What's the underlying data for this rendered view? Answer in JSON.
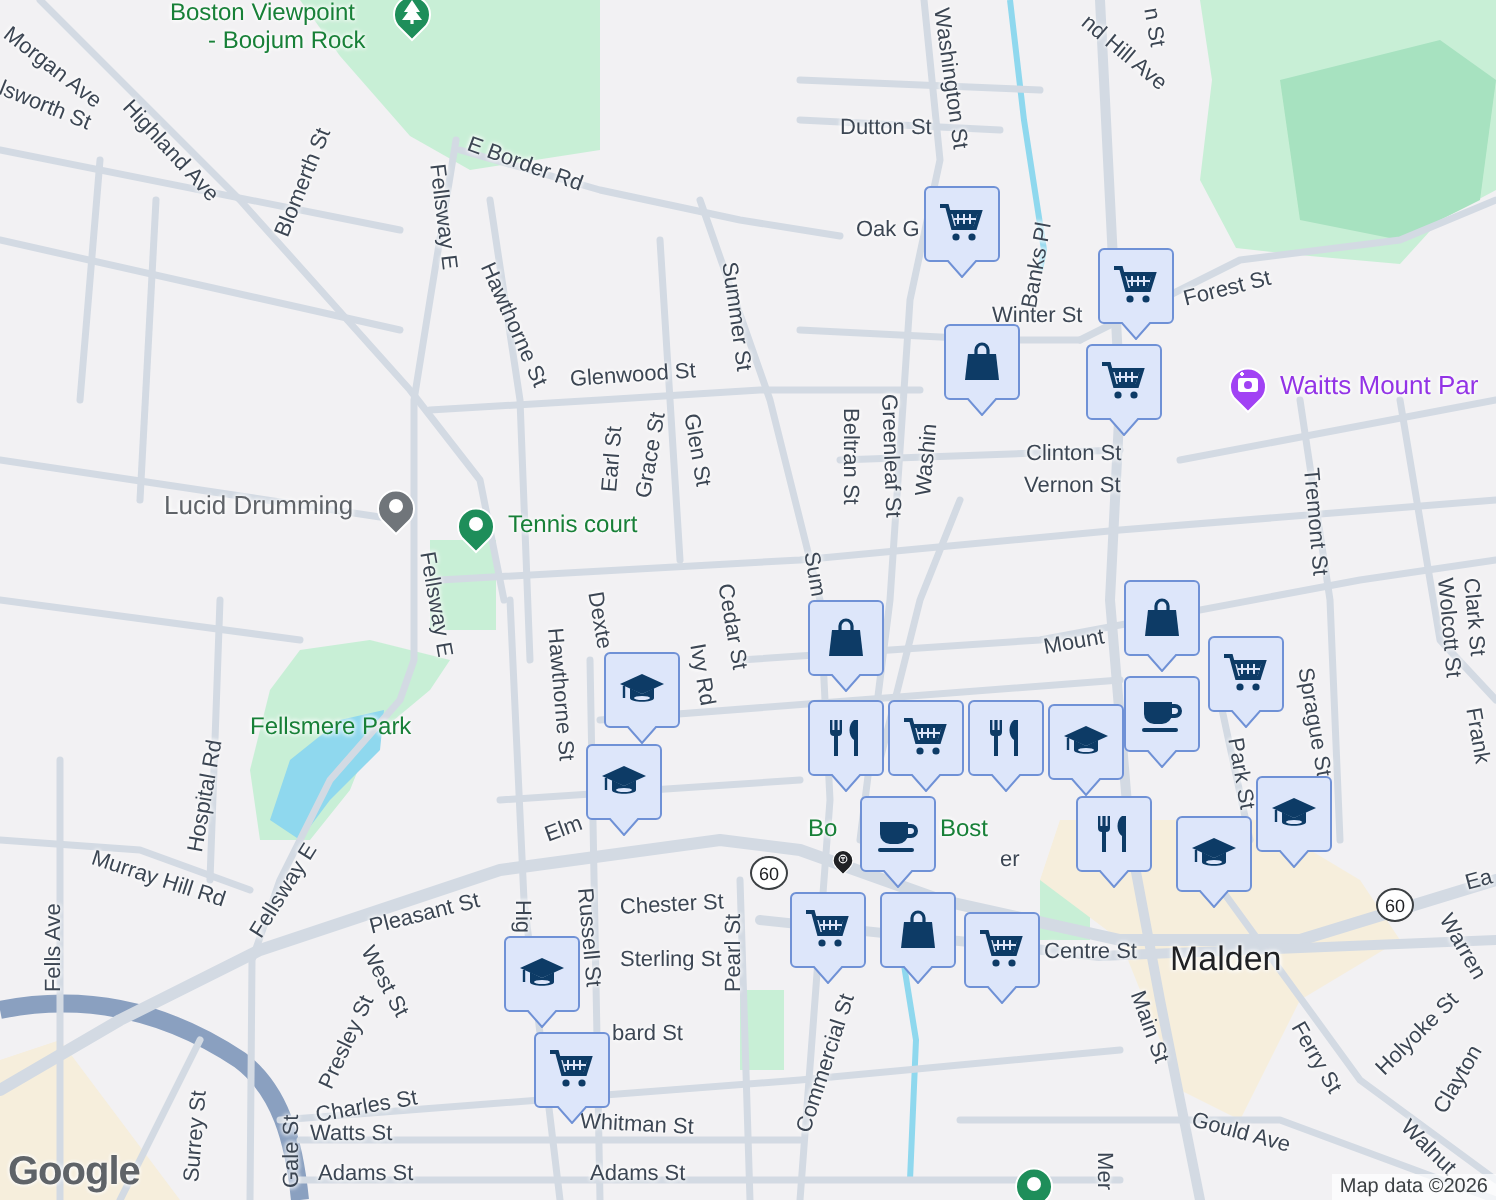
{
  "map": {
    "labels": [
      {
        "text": "Boston Viewpoint",
        "kind": "park"
      },
      {
        "text": "- Boojum Rock",
        "kind": "park"
      },
      {
        "text": "Morgan Ave",
        "kind": "street"
      },
      {
        "text": "lsworth St",
        "kind": "street"
      },
      {
        "text": "Highland Ave",
        "kind": "street"
      },
      {
        "text": "Blomerth St",
        "kind": "street"
      },
      {
        "text": "E Border Rd",
        "kind": "street"
      },
      {
        "text": "Fellsway E",
        "kind": "street"
      },
      {
        "text": "Hawthorne St",
        "kind": "street"
      },
      {
        "text": "Summer St",
        "kind": "street"
      },
      {
        "text": "Glenwood St",
        "kind": "street"
      },
      {
        "text": "Earl St",
        "kind": "street"
      },
      {
        "text": "Grace St",
        "kind": "street"
      },
      {
        "text": "Glen St",
        "kind": "street"
      },
      {
        "text": "Lucid Drumming",
        "kind": "place"
      },
      {
        "text": "Tennis court",
        "kind": "park"
      },
      {
        "text": "Washington St",
        "kind": "street"
      },
      {
        "text": "nd Hill Ave",
        "kind": "street"
      },
      {
        "text": "n St",
        "kind": "street"
      },
      {
        "text": "Dutton St",
        "kind": "street"
      },
      {
        "text": "Oak G",
        "kind": "street"
      },
      {
        "text": "Banks Pl",
        "kind": "street"
      },
      {
        "text": "Winter St",
        "kind": "street"
      },
      {
        "text": "Forest St",
        "kind": "street"
      },
      {
        "text": "Waitts Mount Par",
        "kind": "attraction"
      },
      {
        "text": "Clinton St",
        "kind": "street"
      },
      {
        "text": "Vernon St",
        "kind": "street"
      },
      {
        "text": "Beltran St",
        "kind": "street"
      },
      {
        "text": "Greenleaf St",
        "kind": "street"
      },
      {
        "text": "Washin",
        "kind": "street"
      },
      {
        "text": "Sum",
        "kind": "street"
      },
      {
        "text": "Tremont St",
        "kind": "street"
      },
      {
        "text": "Wolcott St",
        "kind": "street"
      },
      {
        "text": "Clark St",
        "kind": "street"
      },
      {
        "text": "Frank",
        "kind": "street"
      },
      {
        "text": "Mount",
        "kind": "street"
      },
      {
        "text": "Cedar St",
        "kind": "street"
      },
      {
        "text": "Ivy Rd",
        "kind": "street"
      },
      {
        "text": "Dexte",
        "kind": "street"
      },
      {
        "text": "Hawthorne St",
        "kind": "street"
      },
      {
        "text": "Fellsmere Park",
        "kind": "park"
      },
      {
        "text": "Hospital Rd",
        "kind": "street"
      },
      {
        "text": "Murray Hill Rd",
        "kind": "street"
      },
      {
        "text": "Fellsway E",
        "kind": "street"
      },
      {
        "text": "Fellsway E",
        "kind": "street"
      },
      {
        "text": "Pleasant St",
        "kind": "street"
      },
      {
        "text": "West St",
        "kind": "street"
      },
      {
        "text": "Gale St",
        "kind": "street"
      },
      {
        "text": "Presley St",
        "kind": "street"
      },
      {
        "text": "Fells Ave",
        "kind": "street"
      },
      {
        "text": "Hig",
        "kind": "street"
      },
      {
        "text": "Russell St",
        "kind": "street"
      },
      {
        "text": "Chester St",
        "kind": "street"
      },
      {
        "text": "Sterling St",
        "kind": "street"
      },
      {
        "text": "Pearl St",
        "kind": "street"
      },
      {
        "text": "Elm",
        "kind": "street"
      },
      {
        "text": "bard St",
        "kind": "street"
      },
      {
        "text": "Charles St",
        "kind": "street"
      },
      {
        "text": "Watts St",
        "kind": "street"
      },
      {
        "text": "Adams St",
        "kind": "street"
      },
      {
        "text": "Adams St",
        "kind": "street"
      },
      {
        "text": "Whitman St",
        "kind": "street"
      },
      {
        "text": "Surrey St",
        "kind": "street"
      },
      {
        "text": "Commercial St",
        "kind": "street"
      },
      {
        "text": "Centre St",
        "kind": "street"
      },
      {
        "text": "Malden",
        "kind": "city"
      },
      {
        "text": "Main St",
        "kind": "street"
      },
      {
        "text": "Ferry St",
        "kind": "street"
      },
      {
        "text": "Holyoke St",
        "kind": "street"
      },
      {
        "text": "Clayton",
        "kind": "street"
      },
      {
        "text": "Warren",
        "kind": "street"
      },
      {
        "text": "Ea",
        "kind": "street"
      },
      {
        "text": "Walnut",
        "kind": "street"
      },
      {
        "text": "Gould Ave",
        "kind": "street"
      },
      {
        "text": "Mer",
        "kind": "street"
      },
      {
        "text": "Bo",
        "kind": "park"
      },
      {
        "text": "Bost",
        "kind": "park"
      },
      {
        "text": "er",
        "kind": "street"
      },
      {
        "text": "Sprague St",
        "kind": "street"
      },
      {
        "text": "Park St",
        "kind": "street"
      }
    ],
    "poi_markers": [
      {
        "kind": "tree",
        "color": "#1e8e5a"
      },
      {
        "kind": "dot",
        "color": "#70757a"
      },
      {
        "kind": "dot",
        "color": "#1e8e5a"
      },
      {
        "kind": "camera",
        "color": "#a142f4"
      },
      {
        "kind": "transit",
        "color": "#202124"
      },
      {
        "kind": "dot",
        "color": "#1e8e5a"
      }
    ],
    "pins": [
      {
        "kind": "cart"
      },
      {
        "kind": "cart"
      },
      {
        "kind": "bag"
      },
      {
        "kind": "cart"
      },
      {
        "kind": "bag"
      },
      {
        "kind": "cart"
      },
      {
        "kind": "cup"
      },
      {
        "kind": "cap"
      },
      {
        "kind": "cap"
      },
      {
        "kind": "bag"
      },
      {
        "kind": "fork"
      },
      {
        "kind": "cart"
      },
      {
        "kind": "fork"
      },
      {
        "kind": "cap"
      },
      {
        "kind": "cup"
      },
      {
        "kind": "fork"
      },
      {
        "kind": "cap"
      },
      {
        "kind": "cap"
      },
      {
        "kind": "cart"
      },
      {
        "kind": "bag"
      },
      {
        "kind": "cart"
      },
      {
        "kind": "cap"
      },
      {
        "kind": "cart"
      }
    ],
    "route_shields": [
      "60",
      "60"
    ]
  },
  "logo": "Google",
  "attribution": "Map data ©2026"
}
